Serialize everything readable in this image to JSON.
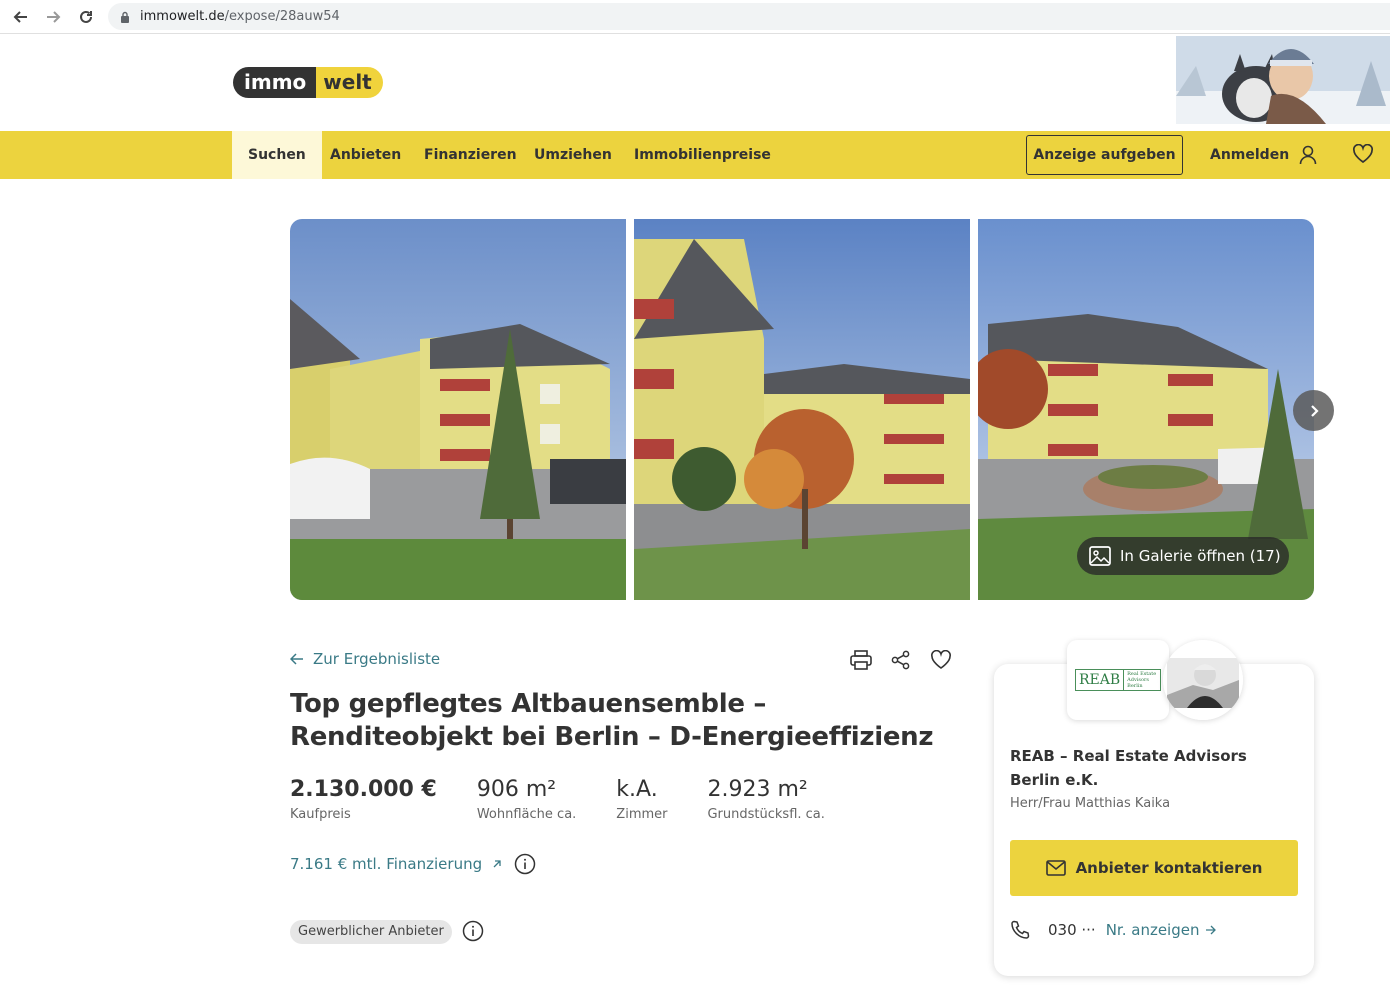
{
  "browser": {
    "url_host": "immowelt.de",
    "url_path": "/expose/28auw54"
  },
  "header": {
    "logo_left": "immo",
    "logo_right": "welt"
  },
  "nav": {
    "items": [
      "Suchen",
      "Anbieten",
      "Finanzieren",
      "Umziehen",
      "Immobilienpreise"
    ],
    "active": "Suchen",
    "cta": "Anzeige aufgeben",
    "login": "Anmelden"
  },
  "gallery": {
    "open_label": "In Galerie öffnen (17)",
    "photo_count": 17
  },
  "listing": {
    "back_label": "Zur Ergebnisliste",
    "title": "Top gepflegtes Altbauensemble – Renditeobjekt bei Berlin – D-Energieeffizienz",
    "facts": [
      {
        "value": "2.130.000 €",
        "label": "Kaufpreis"
      },
      {
        "value": "906 m²",
        "label": "Wohnfläche ca."
      },
      {
        "value": "k.A.",
        "label": "Zimmer"
      },
      {
        "value": "2.923 m²",
        "label": "Grundstücksfl. ca."
      }
    ],
    "financing": "7.161 € mtl. Finanzierung",
    "badge": "Gewerblicher Anbieter"
  },
  "contact": {
    "logo_main": "REAB",
    "logo_sub": "Real Estate Advisors Berlin",
    "company": "REAB – Real Estate Advisors Berlin e.K.",
    "person": "Herr/Frau Matthias Kaika",
    "button": "Anbieter kontaktieren",
    "phone_prefix": "030 ···",
    "phone_show": "Nr. anzeigen"
  },
  "colors": {
    "brand_yellow": "#ecd33e",
    "link_teal": "#3a7a86",
    "text_dark": "#333333"
  }
}
